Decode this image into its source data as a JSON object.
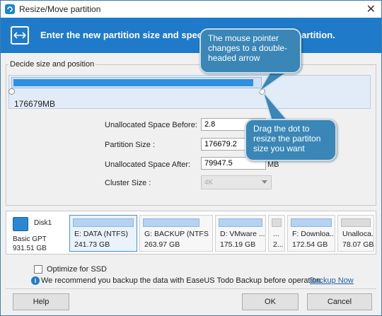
{
  "window": {
    "title": "Resize/Move partition",
    "close_glyph": "✕"
  },
  "banner": {
    "text_start": "Enter the new partition size and speci",
    "text_end": "lected partition."
  },
  "group": {
    "label": "Decide size and position",
    "partition_size_label": "176679MB",
    "partition_fill_fraction": 0.69
  },
  "fields": {
    "unalloc_before_label": "Unallocated Space Before:",
    "unalloc_before_value": "2.8",
    "partition_size_label": "Partition Size :",
    "partition_size_value": "176679.2",
    "unalloc_after_label": "Unallocated Space After:",
    "unalloc_after_value": "79947.5",
    "unit": "MB",
    "cluster_size_label": "Cluster Size :",
    "cluster_size_value": "4K"
  },
  "callouts": {
    "pointer": "The mouse pointer changes to a double-headed arrow",
    "drag": "Drag the dot to resize the partiton size you want"
  },
  "disk": {
    "name": "Disk1",
    "type": "Basic GPT",
    "size": "931.51 GB",
    "partitions": [
      {
        "name": "E: DATA (NTFS)",
        "size": "241.73 GB"
      },
      {
        "name": "G: BACKUP (NTFS",
        "size": "263.97 GB"
      },
      {
        "name": "D: VMware ...",
        "size": "175.19 GB"
      },
      {
        "name": "...",
        "size": "2..."
      },
      {
        "name": "F: Downloa...",
        "size": "172.54 GB"
      },
      {
        "name": "Unalloca...",
        "size": "78.07 GB"
      }
    ]
  },
  "options": {
    "ssd_label": "Optimize for SSD",
    "info_text": "We recommend you backup the data with EaseUS Todo Backup before operation.",
    "backup_link": "Backup Now"
  },
  "buttons": {
    "help": "Help",
    "ok": "OK",
    "cancel": "Cancel"
  },
  "colors": {
    "accent": "#1f7bc9",
    "callout": "#3a86b6",
    "partition_bar": "#2f8fe0"
  }
}
